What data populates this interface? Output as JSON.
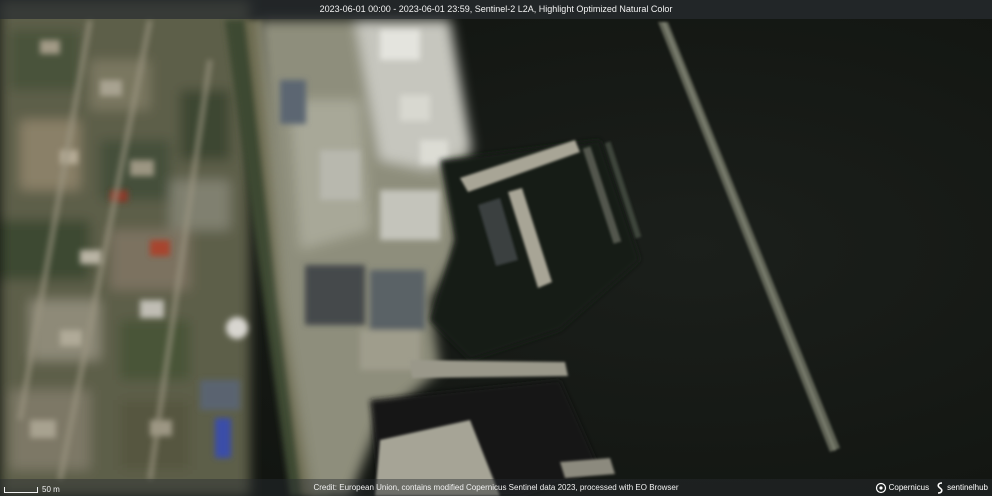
{
  "header": {
    "title": "2023-06-01 00:00 - 2023-06-01 23:59, Sentinel-2 L2A, Highlight Optimized Natural Color"
  },
  "footer": {
    "credit": "Credit: European Union, contains modified Copernicus Sentinel data 2023, processed with EO Browser",
    "scale_label": "50 m",
    "logos": {
      "copernicus": "Copernicus",
      "sentinelhub": "sentinelhub"
    }
  },
  "colors": {
    "sea": "#161a16",
    "land": "#6b6a55",
    "vegetation": "#3f4a32",
    "pier": "#9a9888",
    "overlay": "#282c30"
  }
}
